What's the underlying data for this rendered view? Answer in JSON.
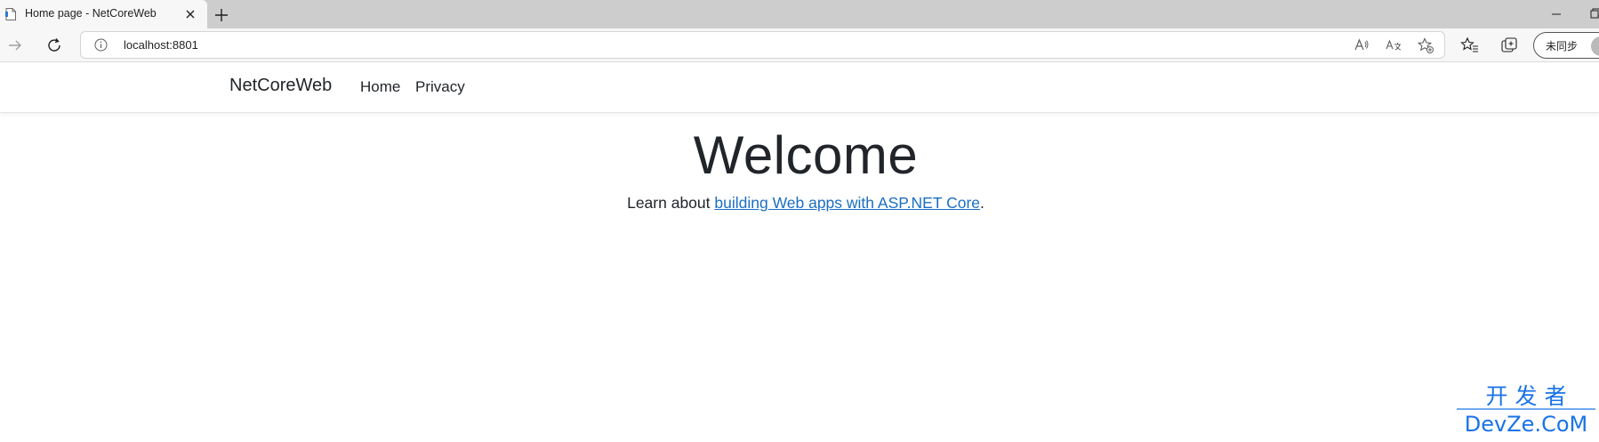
{
  "browser": {
    "tab": {
      "title": "Home page - NetCoreWeb"
    },
    "address_bar": {
      "url": "localhost:8801"
    },
    "profile": {
      "label": "未同步"
    }
  },
  "site": {
    "brand": "NetCoreWeb",
    "nav": [
      {
        "label": "Home"
      },
      {
        "label": "Privacy"
      }
    ]
  },
  "main": {
    "heading": "Welcome",
    "learn_prefix": "Learn about ",
    "learn_link": "building Web apps with ASP.NET Core",
    "learn_suffix": "."
  },
  "watermark": {
    "line1": "开 发 者",
    "line2": "DevZe.CoM"
  },
  "colors": {
    "link": "#1b6ec2",
    "text": "#212529",
    "watermark": "#1a73e8",
    "tabstrip": "#cdcdcd",
    "toolbar": "#f7f7f7"
  },
  "icons": [
    "page-favicon-icon",
    "close-icon",
    "plus-icon",
    "minimize-icon",
    "restore-icon",
    "forward-icon",
    "reload-icon",
    "info-icon",
    "read-aloud-icon",
    "translate-icon",
    "add-favorite-icon",
    "favorites-icon",
    "collections-icon",
    "avatar"
  ]
}
